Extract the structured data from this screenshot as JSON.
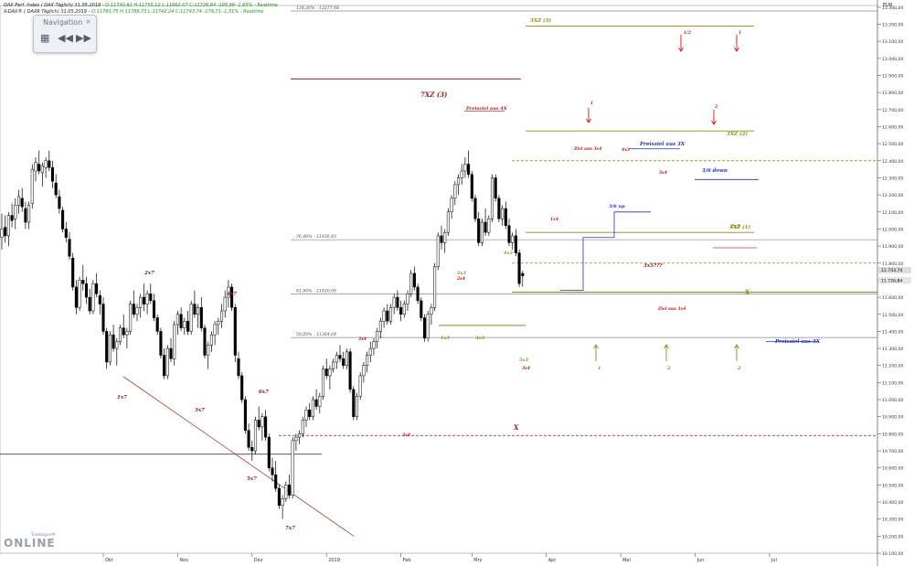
{
  "header": {
    "line1": {
      "text": "DAX Perf. Index ( DAX Täglich) 31.05.2019 - ",
      "quote": "O:11740,92 H:11755,12 L:11662,07 C:11726,84 -195,99 -1,65% - Realtime"
    },
    "line2": {
      "text": "X-DAX® ( DAXR Täglich) 31.05.2019 - ",
      "quote": "O:11783,75 H:11786,73 L:11742,24 C:11743,74 -179,71 -1,51% - Realtime"
    }
  },
  "navigation": {
    "title": "Navigation",
    "close": "×",
    "grid_icon": "grid-icon",
    "back_icon": "rewind-icon",
    "fwd_icon": "fast-forward-icon"
  },
  "logo": {
    "small": "Tradesignal®",
    "big": "online"
  },
  "colors": {
    "up": "#ffffff",
    "down": "#000000",
    "fib": "#888888",
    "target": "#8a8a1a",
    "wave": "#8b1a1a",
    "arrow_red": "#e01010",
    "blue": "#2030d0",
    "red_dash": "#a0102a"
  },
  "chart_data": {
    "type": "candlestick",
    "ylabel": "EUR",
    "ylim": [
      10100,
      13310
    ],
    "y_ticks": [
      10100,
      10200,
      10300,
      10400,
      10500,
      10600,
      10700,
      10800,
      10900,
      11000,
      11100,
      11200,
      11300,
      11400,
      11500,
      11600,
      11700,
      11800,
      11900,
      12000,
      12100,
      12200,
      12300,
      12400,
      12500,
      12600,
      12700,
      12800,
      12900,
      13000,
      13100,
      13200,
      13300
    ],
    "y_tick_labels": [
      "10.100,00",
      "10.200,00",
      "10.300,00",
      "10.400,00",
      "10.500,00",
      "10.600,00",
      "10.700,00",
      "10.800,00",
      "10.900,00",
      "11.000,00",
      "11.100,00",
      "11.200,00",
      "11.300,00",
      "11.400,00",
      "11.500,00",
      "11.600,00",
      "11.700,00",
      "11.800,00",
      "11.900,00",
      "12.000,00",
      "12.100,00",
      "12.200,00",
      "12.300,00",
      "12.400,00",
      "12.500,00",
      "12.600,00",
      "12.700,00",
      "12.800,00",
      "12.900,00",
      "13.000,00",
      "13.100,00",
      "13.200,00",
      "13.300,00"
    ],
    "x_labels": [
      "Okt",
      "Nov",
      "Dez",
      "2019",
      "Feb",
      "Mrz",
      "Apr",
      "Mai",
      "Jun",
      "Jul"
    ],
    "x_label_days": [
      30,
      52,
      74,
      96,
      118,
      139,
      161,
      183,
      205,
      227
    ],
    "last_price_labels": [
      "11.743,74",
      "11.726,84"
    ],
    "candles": [
      [
        0,
        11950,
        12090,
        11880,
        12000
      ],
      [
        1,
        12010,
        12080,
        11920,
        11960
      ],
      [
        2,
        11960,
        12100,
        11900,
        12080
      ],
      [
        3,
        12080,
        12150,
        12010,
        12050
      ],
      [
        4,
        12060,
        12180,
        12000,
        12140
      ],
      [
        5,
        12140,
        12230,
        12090,
        12190
      ],
      [
        6,
        12180,
        12240,
        12100,
        12130
      ],
      [
        7,
        12120,
        12160,
        12000,
        12040
      ],
      [
        8,
        12040,
        12160,
        12000,
        12140
      ],
      [
        9,
        12150,
        12380,
        12120,
        12350
      ],
      [
        10,
        12340,
        12420,
        12280,
        12390
      ],
      [
        11,
        12380,
        12460,
        12320,
        12340
      ],
      [
        12,
        12330,
        12390,
        12250,
        12370
      ],
      [
        13,
        12360,
        12420,
        12300,
        12400
      ],
      [
        14,
        12400,
        12460,
        12340,
        12360
      ],
      [
        15,
        12360,
        12400,
        12240,
        12280
      ],
      [
        16,
        12270,
        12320,
        12180,
        12200
      ],
      [
        17,
        12190,
        12230,
        12090,
        12120
      ],
      [
        18,
        12110,
        12130,
        11980,
        12000
      ],
      [
        19,
        12000,
        12040,
        11920,
        11950
      ],
      [
        20,
        11940,
        11980,
        11820,
        11840
      ],
      [
        21,
        11830,
        11860,
        11640,
        11660
      ],
      [
        22,
        11660,
        11700,
        11500,
        11540
      ],
      [
        23,
        11540,
        11720,
        11520,
        11700
      ],
      [
        24,
        11700,
        11790,
        11640,
        11680
      ],
      [
        25,
        11680,
        11720,
        11560,
        11600
      ],
      [
        26,
        11600,
        11650,
        11500,
        11520
      ],
      [
        27,
        11520,
        11700,
        11500,
        11680
      ],
      [
        28,
        11680,
        11740,
        11600,
        11620
      ],
      [
        29,
        11610,
        11640,
        11500,
        11560
      ],
      [
        30,
        11560,
        11600,
        11380,
        11400
      ],
      [
        31,
        11400,
        11420,
        11180,
        11220
      ],
      [
        32,
        11220,
        11400,
        11200,
        11380
      ],
      [
        33,
        11380,
        11440,
        11280,
        11300
      ],
      [
        34,
        11300,
        11360,
        11200,
        11340
      ],
      [
        35,
        11340,
        11440,
        11320,
        11420
      ],
      [
        36,
        11420,
        11500,
        11360,
        11380
      ],
      [
        37,
        11380,
        11420,
        11300,
        11400
      ],
      [
        38,
        11400,
        11580,
        11380,
        11560
      ],
      [
        39,
        11560,
        11640,
        11480,
        11500
      ],
      [
        40,
        11500,
        11560,
        11460,
        11540
      ],
      [
        41,
        11540,
        11620,
        11480,
        11600
      ],
      [
        42,
        11600,
        11680,
        11520,
        11560
      ],
      [
        43,
        11560,
        11640,
        11500,
        11620
      ],
      [
        44,
        11620,
        11680,
        11560,
        11580
      ],
      [
        45,
        11580,
        11620,
        11460,
        11480
      ],
      [
        46,
        11480,
        11500,
        11380,
        11400
      ],
      [
        47,
        11400,
        11420,
        11240,
        11260
      ],
      [
        48,
        11260,
        11300,
        11120,
        11140
      ],
      [
        49,
        11140,
        11320,
        11120,
        11300
      ],
      [
        50,
        11300,
        11360,
        11220,
        11240
      ],
      [
        51,
        11240,
        11460,
        11200,
        11440
      ],
      [
        52,
        11440,
        11520,
        11380,
        11500
      ],
      [
        53,
        11500,
        11540,
        11400,
        11420
      ],
      [
        54,
        11420,
        11480,
        11380,
        11460
      ],
      [
        55,
        11460,
        11520,
        11380,
        11400
      ],
      [
        56,
        11400,
        11580,
        11380,
        11560
      ],
      [
        57,
        11560,
        11640,
        11480,
        11500
      ],
      [
        58,
        11500,
        11560,
        11420,
        11540
      ],
      [
        59,
        11540,
        11600,
        11400,
        11420
      ],
      [
        60,
        11420,
        11440,
        11240,
        11260
      ],
      [
        61,
        11260,
        11340,
        11180,
        11320
      ],
      [
        62,
        11320,
        11400,
        11280,
        11380
      ],
      [
        63,
        11380,
        11460,
        11320,
        11440
      ],
      [
        64,
        11440,
        11480,
        11380,
        11460
      ],
      [
        65,
        11460,
        11560,
        11420,
        11520
      ],
      [
        66,
        11520,
        11640,
        11480,
        11600
      ],
      [
        67,
        11600,
        11700,
        11540,
        11660
      ],
      [
        68,
        11660,
        11680,
        11520,
        11540
      ],
      [
        69,
        11540,
        11560,
        11220,
        11260
      ],
      [
        70,
        11240,
        11280,
        11120,
        11140
      ],
      [
        71,
        11140,
        11160,
        10980,
        11000
      ],
      [
        72,
        11000,
        11020,
        10800,
        10820
      ],
      [
        73,
        10820,
        10860,
        10700,
        10720
      ],
      [
        74,
        10720,
        10760,
        10640,
        10700
      ],
      [
        75,
        10700,
        10900,
        10680,
        10880
      ],
      [
        76,
        10880,
        10960,
        10820,
        10840
      ],
      [
        77,
        10840,
        10920,
        10760,
        10900
      ],
      [
        78,
        10900,
        10940,
        10760,
        10780
      ],
      [
        79,
        10780,
        10800,
        10580,
        10600
      ],
      [
        80,
        10600,
        10660,
        10520,
        10560
      ],
      [
        81,
        10560,
        10640,
        10460,
        10480
      ],
      [
        82,
        10480,
        10500,
        10360,
        10380
      ],
      [
        83,
        10380,
        10440,
        10300,
        10420
      ],
      [
        84,
        10420,
        10520,
        10400,
        10500
      ],
      [
        85,
        10500,
        10560,
        10420,
        10440
      ],
      [
        86,
        10440,
        10780,
        10420,
        10760
      ],
      [
        87,
        10760,
        10800,
        10700,
        10780
      ],
      [
        88,
        10780,
        10820,
        10740,
        10800
      ],
      [
        89,
        10800,
        10900,
        10780,
        10880
      ],
      [
        90,
        10880,
        10960,
        10840,
        10940
      ],
      [
        91,
        10940,
        10980,
        10880,
        10900
      ],
      [
        92,
        10900,
        11020,
        10880,
        11000
      ],
      [
        93,
        11000,
        11060,
        10940,
        10960
      ],
      [
        94,
        10960,
        11040,
        10920,
        11020
      ],
      [
        95,
        11020,
        11200,
        11000,
        11180
      ],
      [
        96,
        11180,
        11240,
        11120,
        11140
      ],
      [
        97,
        11140,
        11200,
        11060,
        11180
      ],
      [
        98,
        11180,
        11240,
        11160,
        11220
      ],
      [
        99,
        11220,
        11280,
        11180,
        11260
      ],
      [
        100,
        11260,
        11320,
        11220,
        11240
      ],
      [
        101,
        11240,
        11280,
        11180,
        11200
      ],
      [
        102,
        11200,
        11300,
        11180,
        11280
      ],
      [
        103,
        11280,
        11300,
        11040,
        11060
      ],
      [
        104,
        11060,
        11080,
        10880,
        10900
      ],
      [
        105,
        10900,
        11040,
        10880,
        11020
      ],
      [
        106,
        11020,
        11160,
        11000,
        11140
      ],
      [
        107,
        11140,
        11220,
        11100,
        11200
      ],
      [
        108,
        11200,
        11280,
        11160,
        11260
      ],
      [
        109,
        11260,
        11340,
        11220,
        11300
      ],
      [
        110,
        11300,
        11360,
        11260,
        11340
      ],
      [
        111,
        11340,
        11420,
        11300,
        11400
      ],
      [
        112,
        11400,
        11480,
        11360,
        11460
      ],
      [
        113,
        11460,
        11540,
        11420,
        11520
      ],
      [
        114,
        11520,
        11560,
        11440,
        11460
      ],
      [
        115,
        11460,
        11560,
        11440,
        11540
      ],
      [
        116,
        11540,
        11620,
        11500,
        11600
      ],
      [
        117,
        11600,
        11640,
        11520,
        11540
      ],
      [
        118,
        11540,
        11580,
        11460,
        11500
      ],
      [
        119,
        11500,
        11580,
        11480,
        11560
      ],
      [
        120,
        11560,
        11640,
        11520,
        11620
      ],
      [
        121,
        11620,
        11760,
        11600,
        11740
      ],
      [
        122,
        11740,
        11780,
        11640,
        11660
      ],
      [
        123,
        11660,
        11680,
        11560,
        11580
      ],
      [
        124,
        11580,
        11600,
        11460,
        11480
      ],
      [
        125,
        11480,
        11500,
        11340,
        11360
      ],
      [
        126,
        11360,
        11520,
        11340,
        11500
      ],
      [
        127,
        11500,
        11560,
        11440,
        11540
      ],
      [
        128,
        11540,
        11800,
        11520,
        11780
      ],
      [
        129,
        11780,
        11980,
        11760,
        11960
      ],
      [
        130,
        11960,
        12020,
        11880,
        11920
      ],
      [
        131,
        11920,
        12000,
        11860,
        11980
      ],
      [
        132,
        11980,
        12120,
        11960,
        12100
      ],
      [
        133,
        12100,
        12200,
        12060,
        12180
      ],
      [
        134,
        12180,
        12280,
        12140,
        12260
      ],
      [
        135,
        12260,
        12320,
        12200,
        12300
      ],
      [
        136,
        12300,
        12380,
        12260,
        12340
      ],
      [
        137,
        12340,
        12420,
        12300,
        12380
      ],
      [
        138,
        12380,
        12460,
        12300,
        12320
      ],
      [
        139,
        12320,
        12340,
        12160,
        12180
      ],
      [
        140,
        12180,
        12200,
        12040,
        12060
      ],
      [
        141,
        12060,
        12100,
        11900,
        11920
      ],
      [
        142,
        11920,
        12060,
        11900,
        12040
      ],
      [
        143,
        12040,
        12120,
        11960,
        11980
      ],
      [
        144,
        11980,
        12080,
        11960,
        12060
      ],
      [
        145,
        12060,
        12320,
        12040,
        12300
      ],
      [
        146,
        12300,
        12320,
        12160,
        12180
      ],
      [
        147,
        12180,
        12200,
        12040,
        12060
      ],
      [
        148,
        12060,
        12140,
        12020,
        12120
      ],
      [
        149,
        12120,
        12160,
        12000,
        12020
      ],
      [
        150,
        12020,
        12060,
        11900,
        11920
      ],
      [
        151,
        11920,
        11980,
        11880,
        11960
      ],
      [
        152,
        11960,
        12000,
        11840,
        11860
      ],
      [
        153,
        11860,
        11880,
        11660,
        11680
      ],
      [
        154,
        11740,
        11755,
        11662,
        11726
      ]
    ]
  },
  "annotations": {
    "fib_lines": [
      {
        "label": "138,20% - 13277,68",
        "price": 13278
      },
      {
        "label": "76,40% - 11936,83",
        "price": 11937
      },
      {
        "label": "61,80% - 11620,06",
        "price": 11620
      },
      {
        "label": "50,00% - 11364,04",
        "price": 11364
      }
    ],
    "target_lines": [
      {
        "label": "3XZ (3)",
        "price": 13190
      },
      {
        "label": "3XZ (2)",
        "price": 12575
      },
      {
        "label": "3XZ (1)",
        "price": 11980
      },
      {
        "label": "X",
        "price": 11630
      }
    ],
    "texts": {
      "xz7": "7XZ (3)",
      "preisziel_4x": "Preisziel aus 4X",
      "preisziel_3x": "Preisziel aus 3X",
      "preisziel_3x_b": "Preisziel aus 3X",
      "ziel_3x4": "Ziel aus 3x4",
      "ziel_3x4_b": "Ziel aus 3x4",
      "down": "3/6 down",
      "up": "3/6 up",
      "x_mid": "X",
      "x_low": "X",
      "q": "3x5???",
      "w1": "1x7",
      "w2": "2x7",
      "w3": "3x7",
      "w4": "4x7",
      "w5": "5x7",
      "w6": "6x7",
      "w7": "7x7",
      "s1": "1x3",
      "s2": "2x3",
      "s3": "3x3",
      "s4": "4x3",
      "s5": "5x3",
      "s2b": "2x3",
      "a1": "1",
      "a2": "2",
      "a3": "2",
      "r1": "1/2",
      "r2": "1",
      "r3": "1",
      "r4": "2",
      "x4": "3x4",
      "x4b": "3x4",
      "x4c": "3x4",
      "x4d": "3x4",
      "x4e": "1x4",
      "x4f": "2x4",
      "x4g": "4x3"
    }
  }
}
